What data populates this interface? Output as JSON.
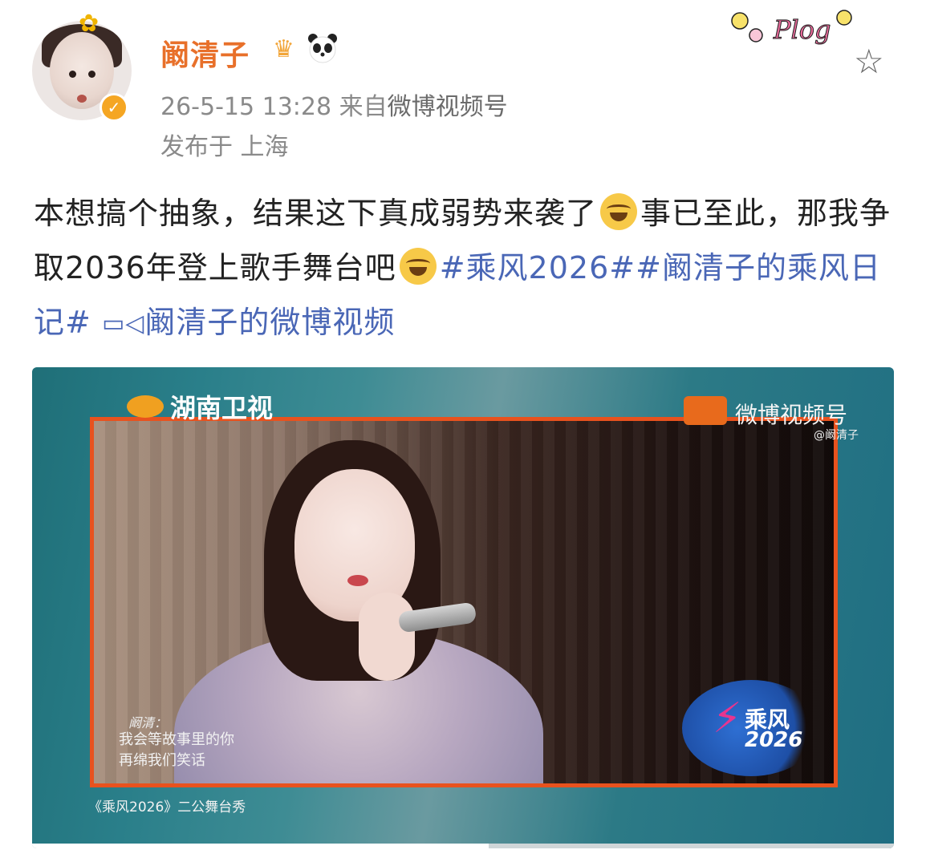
{
  "header": {
    "username": "阚清子",
    "timestamp": "26-5-15 13:28",
    "source_prefix": "来自",
    "source_name": "微博视频号",
    "location": "发布于 上海",
    "verified_icon": "verified-badge-icon",
    "crown_icon": "crown-icon",
    "panda_icon": "panda-icon",
    "plog_label": "Plog",
    "favorite_icon": "star-icon"
  },
  "post": {
    "text_1": "本想搞个抽象，结果这下真成弱势来袭了",
    "text_2": "事已至此，那我争取2036年登上歌手舞台吧",
    "tag_1": "#乘风2026#",
    "tag_2": "#阚清子的乘风日记#",
    "video_link_icon": "video-icon",
    "video_link": "阚清子的微博视频",
    "emoji": "rofl-emoji"
  },
  "video": {
    "channel_logo": "湖南卫视",
    "platform_label": "微博视频号",
    "handle": "@阚清子",
    "lyric_speaker": "阚清：",
    "lyric_line_1": "我会等故事里的你",
    "lyric_line_2": "再绵我们笑话",
    "show_name": "乘风",
    "show_year": "2026",
    "caption": "《乘风2026》二公舞台秀",
    "progress": 0.53
  },
  "colors": {
    "username": "#e8702a",
    "tag": "#4a67b6",
    "meta": "#8a8a8a",
    "frame": "#e8521e"
  }
}
